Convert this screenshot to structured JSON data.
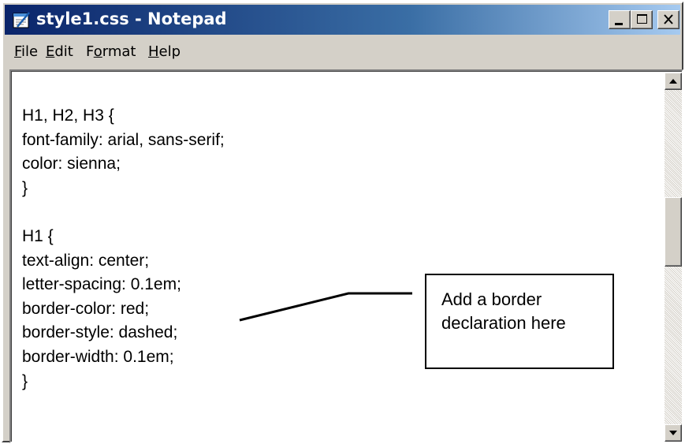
{
  "window": {
    "title": "style1.css - Notepad",
    "icon": "notepad-icon"
  },
  "titlebar_buttons": {
    "minimize": "minimize-icon",
    "maximize": "maximize-icon",
    "close": "close-icon"
  },
  "menu": {
    "items": [
      {
        "hot": "F",
        "rest": "ile"
      },
      {
        "hot": "E",
        "rest": "dit"
      },
      {
        "pre": "F",
        "hot": "o",
        "rest": "rmat"
      },
      {
        "hot": "H",
        "rest": "elp"
      }
    ]
  },
  "editor": {
    "lines": [
      "H1, H2, H3 {",
      "font-family: arial, sans-serif;",
      "color: sienna;",
      "}",
      "",
      "H1 {",
      "text-align: center;",
      "letter-spacing: 0.1em;",
      "border-color: red;",
      "border-style: dashed;",
      "border-width: 0.1em;",
      "}"
    ]
  },
  "annotation": {
    "lines": [
      "Add a border",
      "declaration here"
    ]
  },
  "colors": {
    "title_gradient_start": "#0a246a",
    "title_gradient_end": "#a6caf0",
    "chrome": "#d4d0c8"
  }
}
